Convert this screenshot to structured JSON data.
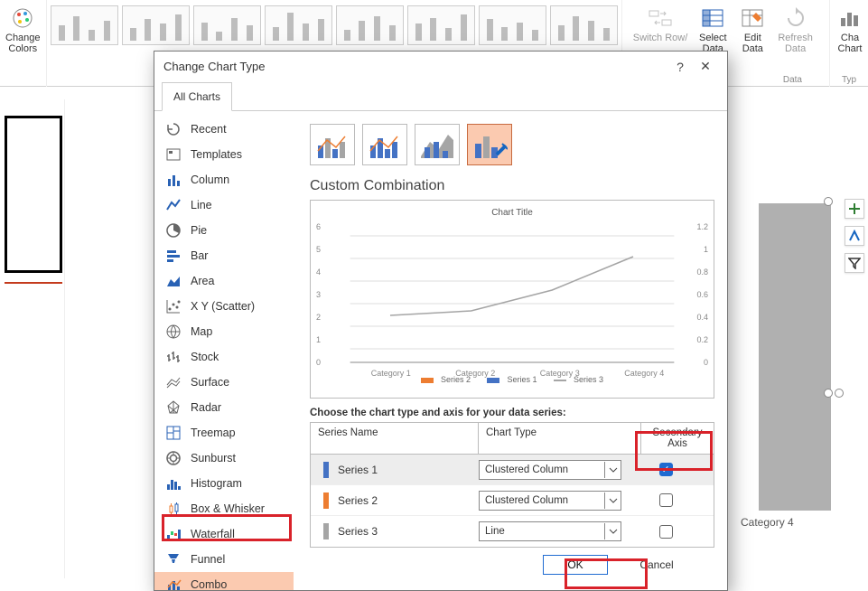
{
  "ribbon": {
    "change_colors": "Change\nColors",
    "switch_row": "Switch Row/",
    "select_data": "Select\nData",
    "edit_data": "Edit\nData",
    "refresh_data": "Refresh\nData",
    "change_chart_type": "Cha\nChart",
    "group_data": "Data",
    "group_type": "Typ"
  },
  "bg": {
    "category_label": "Category 4"
  },
  "dialog": {
    "title": "Change Chart Type",
    "help": "?",
    "close": "✕",
    "tab_all": "All Charts",
    "categories": [
      {
        "key": "recent",
        "label": "Recent"
      },
      {
        "key": "templates",
        "label": "Templates"
      },
      {
        "key": "column",
        "label": "Column"
      },
      {
        "key": "line",
        "label": "Line"
      },
      {
        "key": "pie",
        "label": "Pie"
      },
      {
        "key": "bar",
        "label": "Bar"
      },
      {
        "key": "area",
        "label": "Area"
      },
      {
        "key": "xy",
        "label": "X Y (Scatter)"
      },
      {
        "key": "map",
        "label": "Map"
      },
      {
        "key": "stock",
        "label": "Stock"
      },
      {
        "key": "surface",
        "label": "Surface"
      },
      {
        "key": "radar",
        "label": "Radar"
      },
      {
        "key": "treemap",
        "label": "Treemap"
      },
      {
        "key": "sunburst",
        "label": "Sunburst"
      },
      {
        "key": "histogram",
        "label": "Histogram"
      },
      {
        "key": "boxwhisker",
        "label": "Box & Whisker"
      },
      {
        "key": "waterfall",
        "label": "Waterfall"
      },
      {
        "key": "funnel",
        "label": "Funnel"
      },
      {
        "key": "combo",
        "label": "Combo"
      }
    ],
    "section_title": "Custom Combination",
    "preview": {
      "title": "Chart Title",
      "left_ticks": [
        "6",
        "5",
        "4",
        "3",
        "2",
        "1",
        "0"
      ],
      "right_ticks": [
        "1.2",
        "1",
        "0.8",
        "0.6",
        "0.4",
        "0.2",
        "0"
      ],
      "cats": [
        "Category 1",
        "Category 2",
        "Category 3",
        "Category 4"
      ],
      "legend": [
        "Series 2",
        "Series 1",
        "Series 3"
      ]
    },
    "series_instruction": "Choose the chart type and axis for your data series:",
    "headers": {
      "name": "Series Name",
      "type": "Chart Type",
      "axis": "Secondary Axis"
    },
    "series": [
      {
        "name": "Series 1",
        "type": "Clustered Column",
        "color": "#4472c4",
        "checked": true,
        "selected": true
      },
      {
        "name": "Series 2",
        "type": "Clustered Column",
        "color": "#ed7d31",
        "checked": false,
        "selected": false
      },
      {
        "name": "Series 3",
        "type": "Line",
        "color": "#a5a5a5",
        "checked": false,
        "selected": false
      }
    ],
    "ok": "OK",
    "cancel": "Cancel"
  },
  "chart_data": {
    "type": "bar",
    "title": "Chart Title",
    "categories": [
      "Category 1",
      "Category 2",
      "Category 3",
      "Category 4"
    ],
    "series": [
      {
        "name": "Series 1",
        "type": "column",
        "axis": "secondary",
        "values": [
          null,
          null,
          null,
          null
        ]
      },
      {
        "name": "Series 2",
        "type": "column",
        "axis": "primary",
        "values": [
          null,
          null,
          null,
          null
        ]
      },
      {
        "name": "Series 3",
        "type": "line",
        "axis": "primary",
        "values": [
          2.2,
          2.4,
          3.4,
          5.0
        ]
      }
    ],
    "ylabel": "",
    "xlabel": "",
    "ylim": [
      0,
      6
    ],
    "secondary_ylim": [
      0,
      1.2
    ],
    "legend": [
      "Series 2",
      "Series 1",
      "Series 3"
    ]
  }
}
